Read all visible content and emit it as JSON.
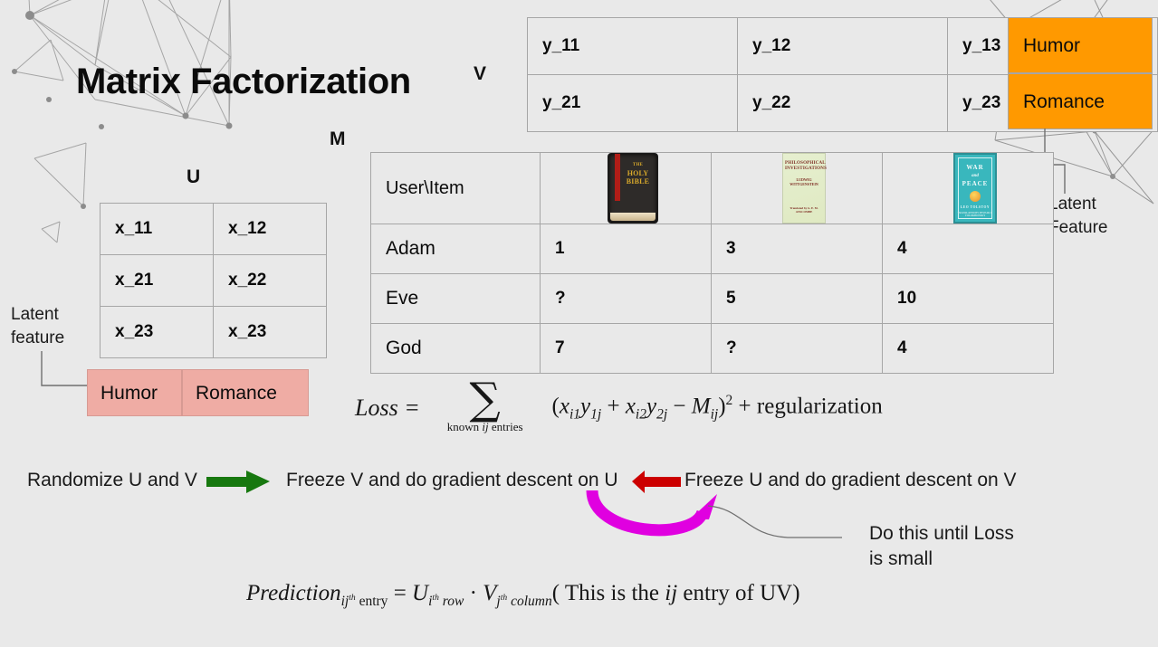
{
  "slide": {
    "title": "Matrix Factorization",
    "background_color": "#e9e9e9",
    "accent_orange": "#ff9900",
    "accent_pink": "#efaca4",
    "arrow_green": "#17780f",
    "arrow_red": "#cc0000",
    "arrow_magenta": "#e000e0"
  },
  "u_matrix": {
    "label": "U",
    "rows": [
      [
        "x_11",
        "x_12"
      ],
      [
        "x_21",
        "x_22"
      ],
      [
        "x_23",
        "x_23"
      ]
    ],
    "latent_caption": "Latent\nfeature",
    "latent_caption_line1": "Latent",
    "latent_caption_line2": "feature",
    "latent_features": [
      "Humor",
      "Romance"
    ]
  },
  "v_matrix": {
    "label": "V",
    "rows": [
      [
        "y_11",
        "y_12",
        "y_13"
      ],
      [
        "y_21",
        "y_22",
        "y_23"
      ]
    ],
    "latent_caption_line1": "Latent",
    "latent_caption_line2": "Feature",
    "latent_features": [
      "Humor",
      "Romance"
    ]
  },
  "m_matrix": {
    "label": "M",
    "corner_header": "User\\Item",
    "item_covers": [
      {
        "name": "holy-bible-book-cover",
        "title_top": "THE",
        "title_mid": "HOLY",
        "title_bot": "BIBLE"
      },
      {
        "name": "philosophical-investigations-book-cover",
        "title": "PHILOSOPHICAL INVESTIGATIONS",
        "author": "LUDWIG WITTGENSTEIN",
        "footer": "Translated by G. E. M. ANSCOMBE"
      },
      {
        "name": "war-and-peace-book-cover",
        "title_top": "WAR",
        "title_mid": "and",
        "title_bot": "PEACE",
        "author": "LEO TOLSTOY",
        "footer": "TRANSLATED BY PEVEAR & VOLOKHONSKY"
      }
    ],
    "rows": [
      {
        "user": "Adam",
        "ratings": [
          "1",
          "3",
          "4"
        ]
      },
      {
        "user": "Eve",
        "ratings": [
          "?",
          "5",
          "10"
        ]
      },
      {
        "user": "God",
        "ratings": [
          "7",
          "?",
          "4"
        ]
      }
    ]
  },
  "loss_formula": {
    "lhs": "Loss =",
    "sigma": "∑",
    "sum_limit": "known ij entries",
    "sum_limit_prefix": "known ",
    "sum_limit_index": "ij",
    "sum_limit_suffix": " entries",
    "body_open": "(",
    "term1_base": "x",
    "term1_sub": "i1",
    "term2_base": "y",
    "term2_sub": "1j",
    "plus": "+",
    "term3_base": "x",
    "term3_sub": "i2",
    "term4_base": "y",
    "term4_sub": "2j",
    "minus": "−",
    "term5_base": "M",
    "term5_sub": "ij",
    "body_close": ")",
    "exponent": "2",
    "tail": "+ regularization"
  },
  "process": {
    "step1": "Randomize U and V",
    "step2": "Freeze V and do gradient descent on U",
    "step3": "Freeze U and do gradient descent on V",
    "loop_note_line1": "Do this until Loss",
    "loop_note_line2": "is small",
    "arrow1_name": "green-right-arrow",
    "arrow2_name": "red-left-arrow",
    "arrow3_name": "magenta-loop-arrow"
  },
  "prediction_formula": {
    "lhs_base": "Prediction",
    "lhs_sub_index": "ij",
    "lhs_sub_th": "th",
    "lhs_sub_word": " entry",
    "equals": "=",
    "u_base": "U",
    "u_sub_index": "i",
    "u_sub_th": "th",
    "u_sub_word": " row",
    "dot": "·",
    "v_base": "V",
    "v_sub_index": "j",
    "v_sub_th": "th",
    "v_sub_word": " column",
    "note_open": "( This is the ",
    "note_index": "ij",
    "note_close": " entry of UV)"
  }
}
